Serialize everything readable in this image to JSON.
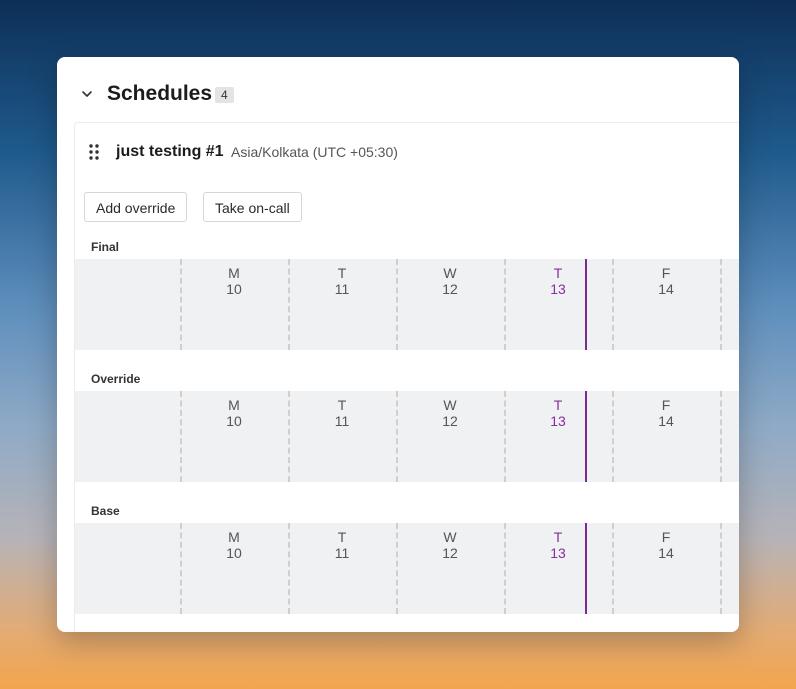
{
  "section": {
    "title": "Schedules",
    "count": "4"
  },
  "schedule": {
    "name": "just testing #1",
    "timezone": "Asia/Kolkata (UTC +05:30)"
  },
  "actions": {
    "add_override": "Add override",
    "take_oncall": "Take on-call"
  },
  "rows": {
    "final": "Final",
    "override": "Override",
    "base": "Base"
  },
  "days": [
    {
      "letter": "M",
      "date": "10"
    },
    {
      "letter": "T",
      "date": "11"
    },
    {
      "letter": "W",
      "date": "12"
    },
    {
      "letter": "T",
      "date": "13"
    },
    {
      "letter": "F",
      "date": "14"
    }
  ],
  "today_index": 3,
  "colors": {
    "today": "#8a2d9e",
    "now_line": "#7b2a8f",
    "track": "#f0f1f3"
  }
}
